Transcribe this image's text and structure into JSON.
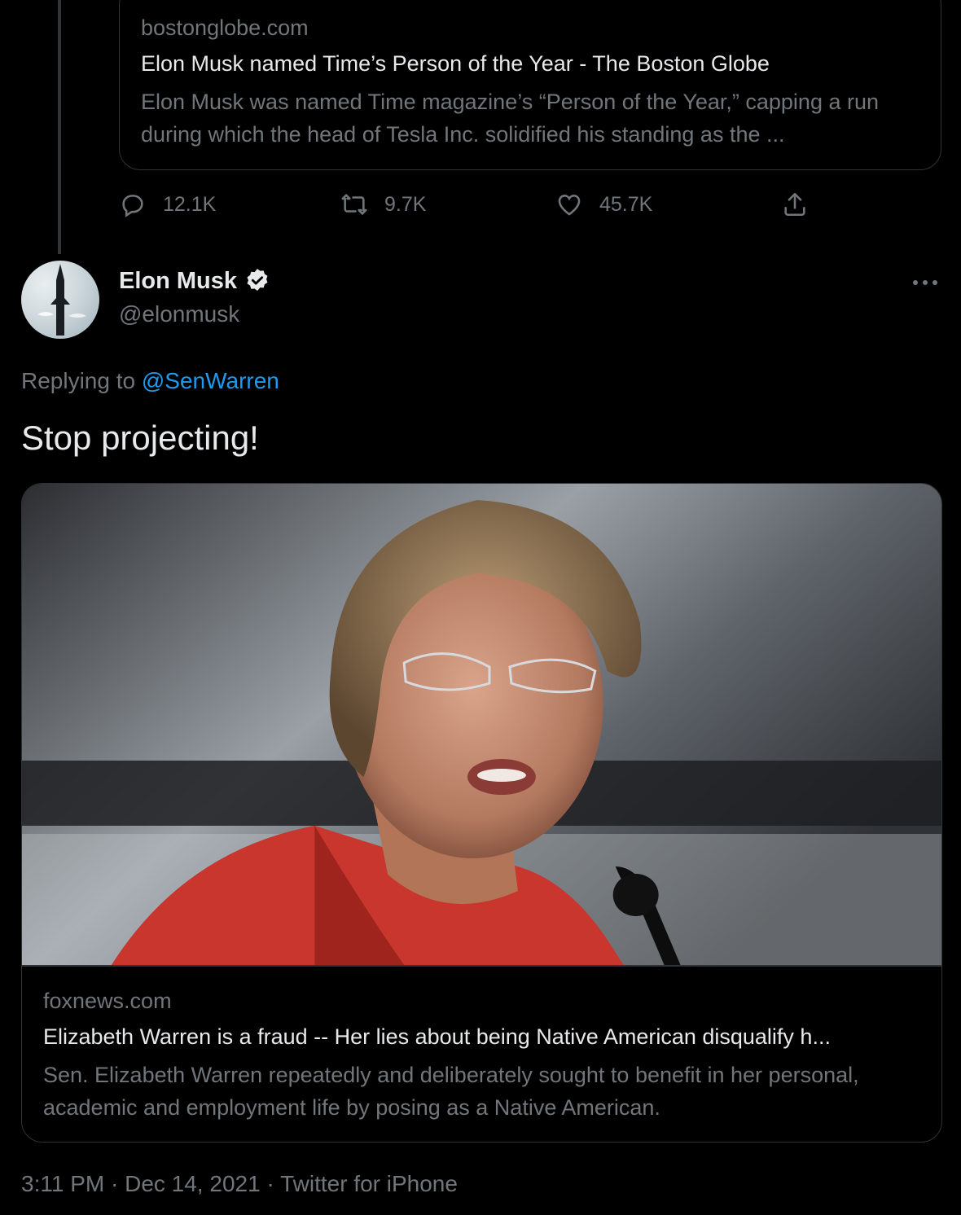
{
  "previous_tweet": {
    "card": {
      "domain": "bostonglobe.com",
      "title": "Elon Musk named Time’s Person of the Year - The Boston Globe",
      "description": "Elon Musk was named Time magazine’s “Person of the Year,” capping a run during which the head of Tesla Inc. solidified his standing as the ..."
    },
    "actions": {
      "replies": "12.1K",
      "retweets": "9.7K",
      "likes": "45.7K"
    }
  },
  "tweet": {
    "author_name": "Elon Musk",
    "author_handle": "@elonmusk",
    "verified": true,
    "replying_prefix": "Replying to ",
    "replying_to": "@SenWarren",
    "text": "Stop projecting!",
    "card": {
      "domain": "foxnews.com",
      "title": "Elizabeth Warren is a fraud -- Her lies about being Native American disqualify h...",
      "description": "Sen. Elizabeth Warren repeatedly and deliberately sought to benefit in her personal, academic and employment life by posing as a Native American."
    },
    "time": "3:11 PM",
    "date": "Dec 14, 2021",
    "source": "Twitter for iPhone",
    "separator": "·"
  },
  "icons": {
    "reply": "reply-icon",
    "retweet": "retweet-icon",
    "like": "heart-icon",
    "share": "share-icon",
    "more": "more-icon",
    "verified": "verified-badge-icon"
  },
  "colors": {
    "background": "#000000",
    "text": "#e7e9ea",
    "muted": "#71767b",
    "accent": "#1d9bf0",
    "border": "#2f3336"
  }
}
